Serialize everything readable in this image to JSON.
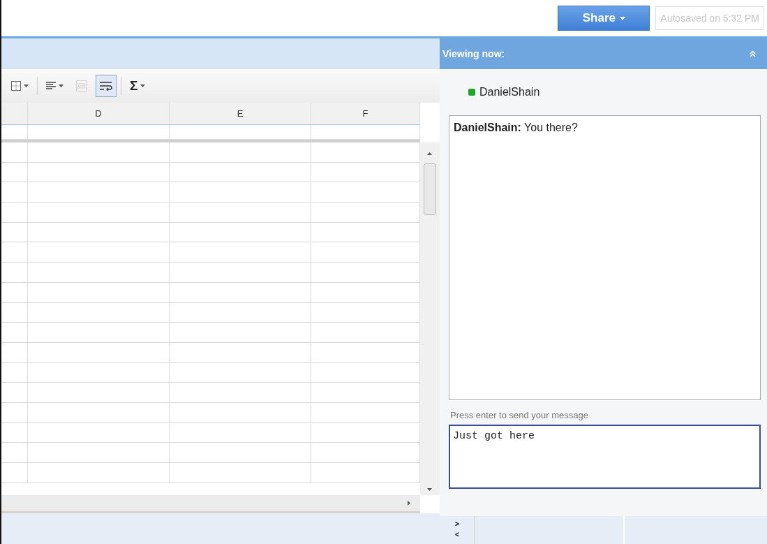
{
  "top_bar": {
    "share_button": {
      "label": "Share"
    },
    "autosave": {
      "text": "Autosaved on 5:32 PM",
      "disabled": true
    }
  },
  "toolbar": [
    {
      "kind": "borders",
      "menu": true,
      "selected": false,
      "disabled": false
    },
    {
      "kind": "align",
      "menu": true,
      "selected": false,
      "disabled": false
    },
    {
      "kind": "merge",
      "menu": false,
      "selected": false,
      "disabled": true
    },
    {
      "kind": "wrap",
      "menu": false,
      "selected": true,
      "disabled": false
    },
    {
      "kind": "sum",
      "label": "Σ",
      "menu": true,
      "selected": false,
      "disabled": false
    }
  ],
  "sheet": {
    "columns": [
      "D",
      "E",
      "F"
    ]
  },
  "side_panel": {
    "title": "Viewing now:",
    "viewers": [
      {
        "name": "DanielShain",
        "color": "#22a32a"
      }
    ],
    "messages": [
      {
        "author": "DanielShain:",
        "text": "You there?"
      }
    ],
    "input_label": "Press enter to send your message",
    "input_value": "Just got here",
    "expand_arrows": [
      ">",
      "<"
    ]
  }
}
